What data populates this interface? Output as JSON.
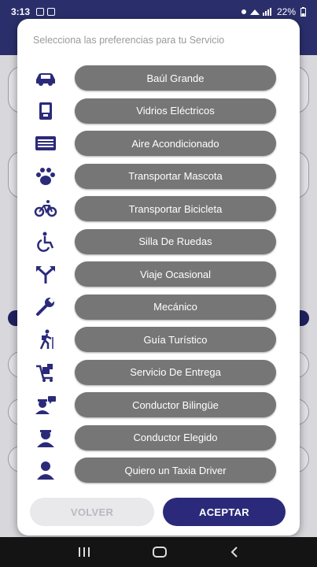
{
  "status_bar": {
    "time": "3:13",
    "battery": "22%"
  },
  "modal": {
    "title": "Selecciona las preferencias para tu Servicio",
    "preferences": [
      {
        "label": "Baúl Grande",
        "icon": "car-icon"
      },
      {
        "label": "Vidrios Eléctricos",
        "icon": "window-icon"
      },
      {
        "label": "Aire Acondicionado",
        "icon": "air-conditioner-icon"
      },
      {
        "label": "Transportar Mascota",
        "icon": "paw-icon"
      },
      {
        "label": "Transportar Bicicleta",
        "icon": "bicycle-icon"
      },
      {
        "label": "Silla De Ruedas",
        "icon": "wheelchair-icon"
      },
      {
        "label": "Viaje Ocasional",
        "icon": "split-arrows-icon"
      },
      {
        "label": "Mecánico",
        "icon": "wrench-icon"
      },
      {
        "label": "Guía Turístico",
        "icon": "hiker-icon"
      },
      {
        "label": "Servicio De Entrega",
        "icon": "delivery-cart-icon"
      },
      {
        "label": "Conductor Bilingüe",
        "icon": "bilingual-driver-icon"
      },
      {
        "label": "Conductor Elegido",
        "icon": "driver-icon"
      },
      {
        "label": "Quiero un Taxia Driver",
        "icon": "person-icon"
      }
    ],
    "back_label": "VOLVER",
    "accept_label": "ACEPTAR"
  },
  "nav": {
    "recents": "|||",
    "home": "○",
    "back": "<"
  },
  "colors": {
    "accent": "#2b2a7a",
    "pref_button": "#767676",
    "icon": "#2b2a7a"
  }
}
